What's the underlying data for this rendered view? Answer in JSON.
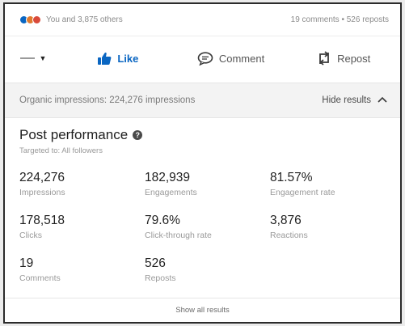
{
  "social": {
    "reactors_text": "You and 3,875 others",
    "comments_reposts_text": "19 comments • 526 reposts",
    "reaction_colors": [
      "#0a66c2",
      "#e07a2e",
      "#d94a3a"
    ]
  },
  "actions": {
    "like_label": "Like",
    "comment_label": "Comment",
    "repost_label": "Repost"
  },
  "organic": {
    "impressions_text": "Organic impressions: 224,276 impressions",
    "hide_results_label": "Hide results"
  },
  "performance": {
    "title": "Post performance",
    "subtitle": "Targeted to: All followers",
    "metrics": [
      {
        "value": "224,276",
        "label": "Impressions"
      },
      {
        "value": "182,939",
        "label": "Engagements"
      },
      {
        "value": "81.57%",
        "label": "Engagement rate"
      },
      {
        "value": "178,518",
        "label": "Clicks"
      },
      {
        "value": "79.6%",
        "label": "Click-through rate"
      },
      {
        "value": "3,876",
        "label": "Reactions"
      },
      {
        "value": "19",
        "label": "Comments"
      },
      {
        "value": "526",
        "label": "Reposts"
      }
    ]
  },
  "footer": {
    "show_all_label": "Show all results"
  },
  "colors": {
    "accent": "#0a66c2"
  }
}
